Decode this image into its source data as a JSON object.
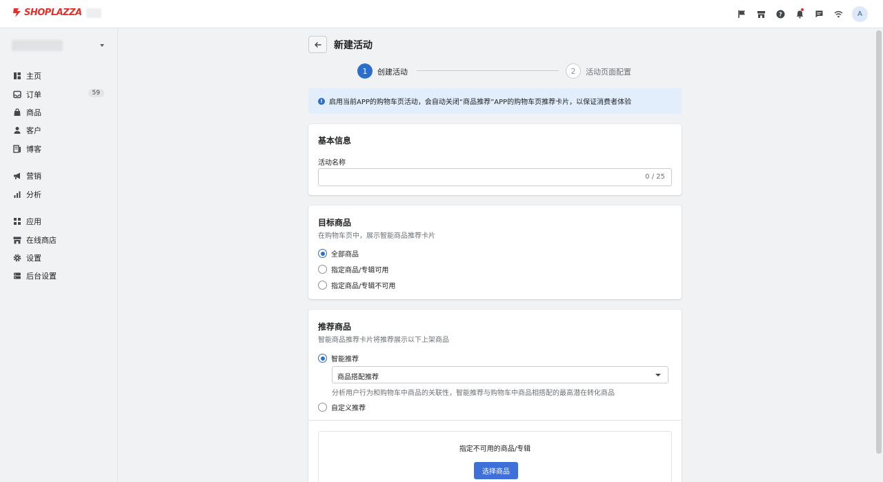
{
  "header": {
    "logo_text": "SHOPLAZZA",
    "avatar_letter": "A",
    "icons": [
      "flag-icon",
      "store-icon",
      "help-icon",
      "bell-icon",
      "chat-icon",
      "wifi-icon"
    ]
  },
  "sidebar": {
    "items": [
      {
        "label": "主页",
        "icon": "home-icon"
      },
      {
        "label": "订单",
        "icon": "inbox-icon",
        "badge": "59"
      },
      {
        "label": "商品",
        "icon": "bag-icon"
      },
      {
        "label": "客户",
        "icon": "person-icon"
      },
      {
        "label": "博客",
        "icon": "blog-icon"
      },
      {
        "label": "营销",
        "icon": "megaphone-icon"
      },
      {
        "label": "分析",
        "icon": "bar-chart-icon"
      },
      {
        "label": "应用",
        "icon": "apps-icon"
      },
      {
        "label": "在线商店",
        "icon": "online-store-icon"
      },
      {
        "label": "设置",
        "icon": "gear-icon"
      },
      {
        "label": "后台设置",
        "icon": "server-icon"
      }
    ]
  },
  "page": {
    "title": "新建活动",
    "steps": [
      {
        "number": "1",
        "label": "创建活动"
      },
      {
        "number": "2",
        "label": "活动页面配置"
      }
    ],
    "banner": "启用当前APP的购物车页活动，会自动关闭“商品推荐”APP的购物车页推荐卡片，以保证消费者体验"
  },
  "basic_info": {
    "title": "基本信息",
    "name_label": "活动名称",
    "name_value": "",
    "counter": "0 / 25"
  },
  "target_products": {
    "title": "目标商品",
    "subtitle": "在购物车页中，展示智能商品推荐卡片",
    "options": [
      "全部商品",
      "指定商品/专辑可用",
      "指定商品/专辑不可用"
    ],
    "selected": "全部商品"
  },
  "recommended_products": {
    "title": "推荐商品",
    "subtitle": "智能商品推荐卡片将推荐展示以下上架商品",
    "option_smart": "智能推荐",
    "select_value": "商品搭配推荐",
    "select_help": "分析用户行为和购物车中商品的关联性，智能推荐与购物车中商品相搭配的最高潜在转化商品",
    "option_custom": "自定义推荐",
    "selected": "智能推荐",
    "exclude_title": "指定不可用的商品/专辑",
    "select_button": "选择商品"
  },
  "colors": {
    "accent": "#2c6ecb",
    "brand": "#e0312c",
    "button": "#3f6fd8",
    "banner_bg": "#e2eefc"
  }
}
